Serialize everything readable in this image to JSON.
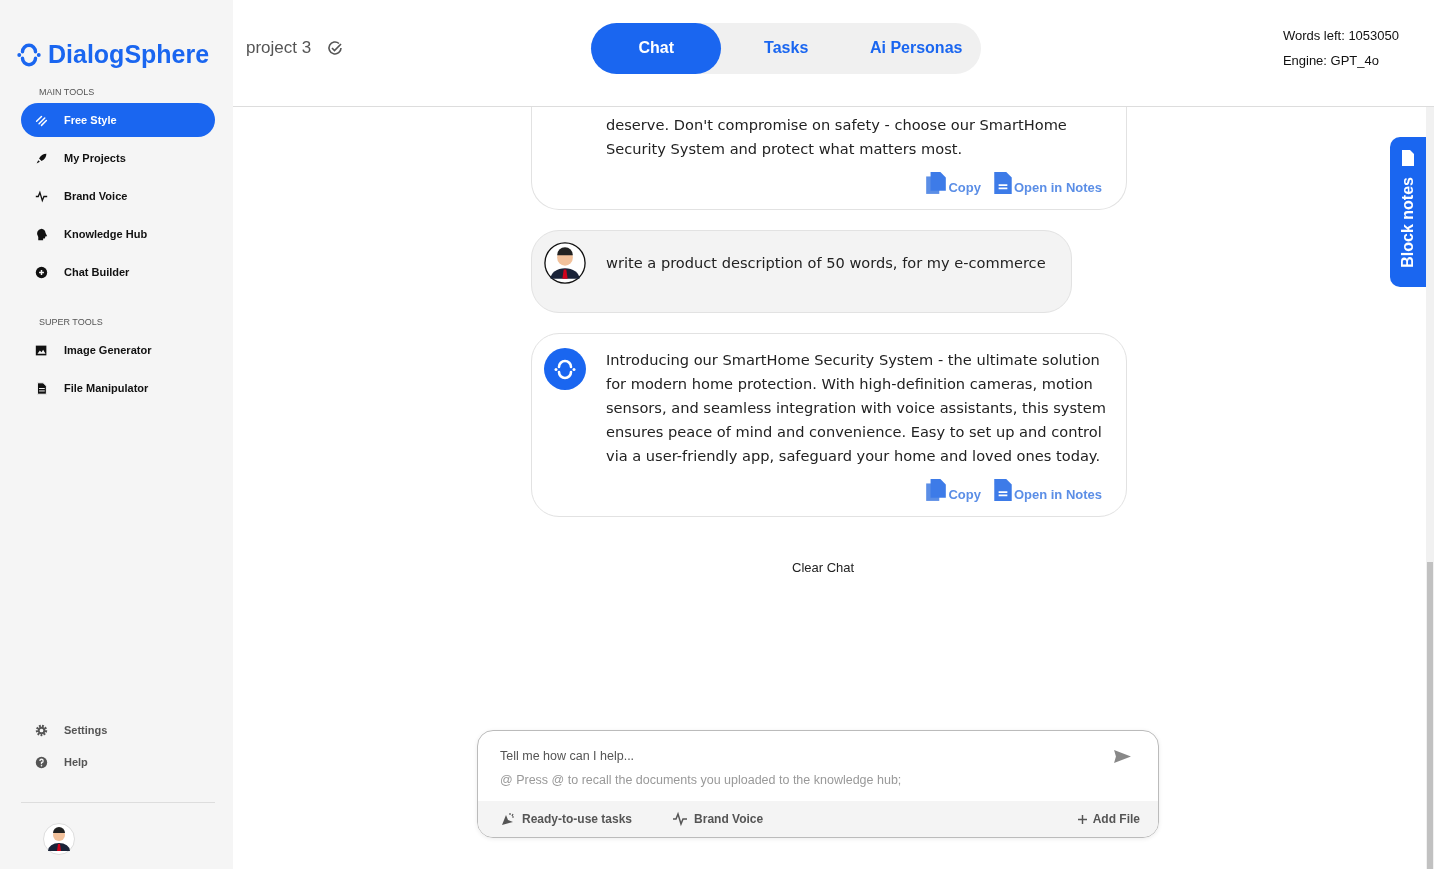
{
  "brand": {
    "name": "DialogSphere"
  },
  "sidebar": {
    "sections": [
      {
        "title": "MAIN TOOLS",
        "items": [
          {
            "label": "Free Style",
            "selected": true
          },
          {
            "label": "My Projects",
            "selected": false
          },
          {
            "label": "Brand Voice",
            "selected": false
          },
          {
            "label": "Knowledge Hub",
            "selected": false
          },
          {
            "label": "Chat Builder",
            "selected": false
          }
        ]
      },
      {
        "title": "SUPER TOOLS",
        "items": [
          {
            "label": "Image Generator",
            "selected": false
          },
          {
            "label": "File Manipulator",
            "selected": false
          }
        ]
      }
    ],
    "footer_items": [
      {
        "label": "Settings"
      },
      {
        "label": "Help"
      }
    ]
  },
  "header": {
    "project": "project 3",
    "tabs": [
      {
        "label": "Chat",
        "selected": true
      },
      {
        "label": "Tasks",
        "selected": false
      },
      {
        "label": "Ai Personas",
        "selected": false
      }
    ],
    "words_left": "Words left: 1053050",
    "engine": "Engine: GPT_4o"
  },
  "messages": [
    {
      "kind": "assistant",
      "cut_top": true,
      "text": "deserve. Don't compromise on safety - choose our SmartHome Security System and protect what matters most.",
      "actions": [
        "Copy",
        "Open in Notes"
      ]
    },
    {
      "kind": "user",
      "cut_top": false,
      "text": "write a product description of 50 words, for my e-commerce"
    },
    {
      "kind": "assistant",
      "cut_top": false,
      "text": "Introducing our SmartHome Security System - the ultimate solution for modern home protection. With high-definition cameras, motion sensors, and seamless integration with voice assistants, this system ensures peace of mind and convenience. Easy to set up and control via a user-friendly app, safeguard your home and loved ones today.",
      "actions": [
        "Copy",
        "Open in Notes"
      ]
    }
  ],
  "clear_chat": "Clear Chat",
  "composer": {
    "placeholder": "Tell me how can I help...",
    "hint": "@ Press @ to recall the documents you uploaded to the knowledge hub;",
    "tools": [
      "Ready-to-use tasks",
      "Brand Voice"
    ],
    "add_file": "Add File"
  },
  "block_notes": "Block notes"
}
